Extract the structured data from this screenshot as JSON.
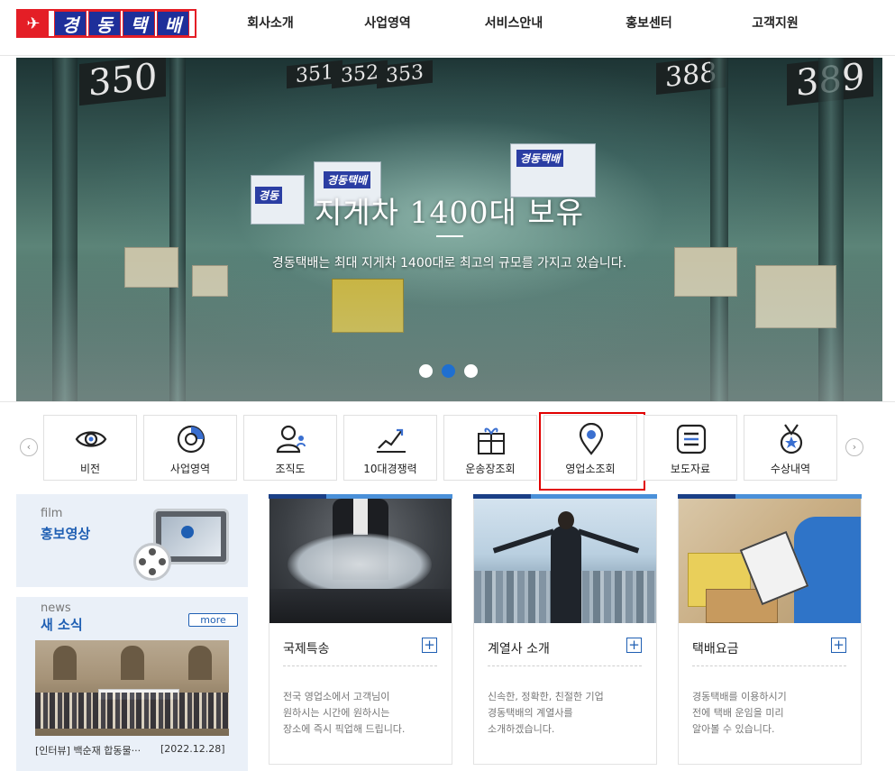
{
  "header": {
    "logo_text": [
      "경",
      "동",
      "택",
      "배"
    ],
    "nav": [
      "회사소개",
      "사업영역",
      "서비스안내",
      "홍보센터",
      "고객지원"
    ]
  },
  "hero": {
    "title": "지게차 1400대 보유",
    "subtitle": "경동택배는 최대 지게차 1400대로 최고의 규모를 가지고 있습니다.",
    "bay_numbers": [
      "350",
      "351",
      "352",
      "353",
      "388",
      "389"
    ],
    "truck_labels": [
      "경동택배",
      "경동택배",
      "경동"
    ],
    "slide_count": 3,
    "active_slide": 2
  },
  "quick_menu": {
    "prev_icon": "chevron-left-icon",
    "next_icon": "chevron-right-icon",
    "items": [
      {
        "label": "비전",
        "icon": "eye-icon"
      },
      {
        "label": "사업영역",
        "icon": "pie-chart-icon"
      },
      {
        "label": "조직도",
        "icon": "person-icon"
      },
      {
        "label": "10대경쟁력",
        "icon": "trend-chart-icon"
      },
      {
        "label": "운송장조회",
        "icon": "gift-box-icon"
      },
      {
        "label": "영업소조회",
        "icon": "map-pin-icon"
      },
      {
        "label": "보도자료",
        "icon": "document-icon"
      },
      {
        "label": "수상내역",
        "icon": "medal-icon"
      }
    ],
    "highlighted": "영업소조회"
  },
  "film": {
    "title_en": "film",
    "title_ko": "홍보영상"
  },
  "news": {
    "title_en": "news",
    "title_ko": "새 소식",
    "more_label": "more",
    "caption": "[인터뷰] 백순재 합동물···",
    "date": "[2022.12.28]"
  },
  "cards": [
    {
      "title": "국제특송",
      "desc": [
        "전국 영업소에서 고객님이",
        "원하시는 시간에 원하시는",
        "장소에 즉시 픽업해 드립니다."
      ]
    },
    {
      "title": "계열사 소개",
      "desc": [
        "신속한, 정확한, 친절한 기업",
        "경동택배의 계열사를",
        "소개하겠습니다."
      ]
    },
    {
      "title": "택배요금",
      "desc": [
        "경동택배를 이용하시기",
        "전에 택배 운임을 미리",
        "알아볼 수 있습니다."
      ]
    }
  ],
  "colors": {
    "brand_blue": "#1f5fb3",
    "brand_red": "#e41e26",
    "highlight": "#e10000"
  }
}
